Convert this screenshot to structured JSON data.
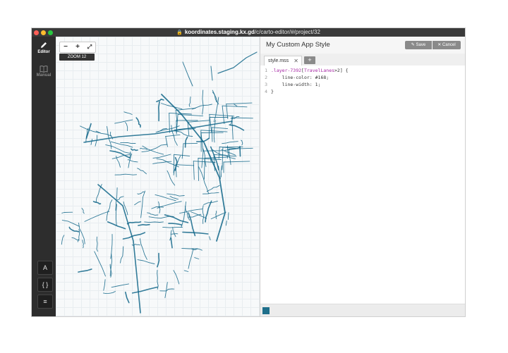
{
  "window": {
    "url_host": "koordinates.staging.kx.gd",
    "url_path": "/c/carto-editor/#/project/32"
  },
  "sidebar": {
    "tabs": [
      {
        "label": "Editor",
        "icon": "pencil-icon",
        "active": true
      },
      {
        "label": "Manual",
        "icon": "book-icon",
        "active": false
      }
    ],
    "buttons": [
      {
        "label": "A",
        "icon": "font-icon"
      },
      {
        "label": "{ }",
        "icon": "braces-icon"
      },
      {
        "label": "≡",
        "icon": "layers-icon"
      }
    ]
  },
  "map": {
    "zoom_out": "−",
    "zoom_in": "+",
    "fullscreen": "⤢",
    "zoom_label": "ZOOM 12",
    "line_color": "#168"
  },
  "editor": {
    "title": "My Custom App Style",
    "save_label": "Save",
    "cancel_label": "Cancel",
    "tab_name": "style.mss",
    "tab_close": "✕",
    "add_tab": "+",
    "code": {
      "l1_sel": ".layer-7392",
      "l1_open": "[",
      "l1_attr": "TravelLanes",
      "l1_cond": ">2] {",
      "l2_prop": "line-color: ",
      "l2_val": "#168",
      "l2_end": ";",
      "l3_prop": "line-width: ",
      "l3_val": "1",
      "l3_end": ";",
      "l4": "}"
    },
    "status_color": "#1f6f8b"
  }
}
